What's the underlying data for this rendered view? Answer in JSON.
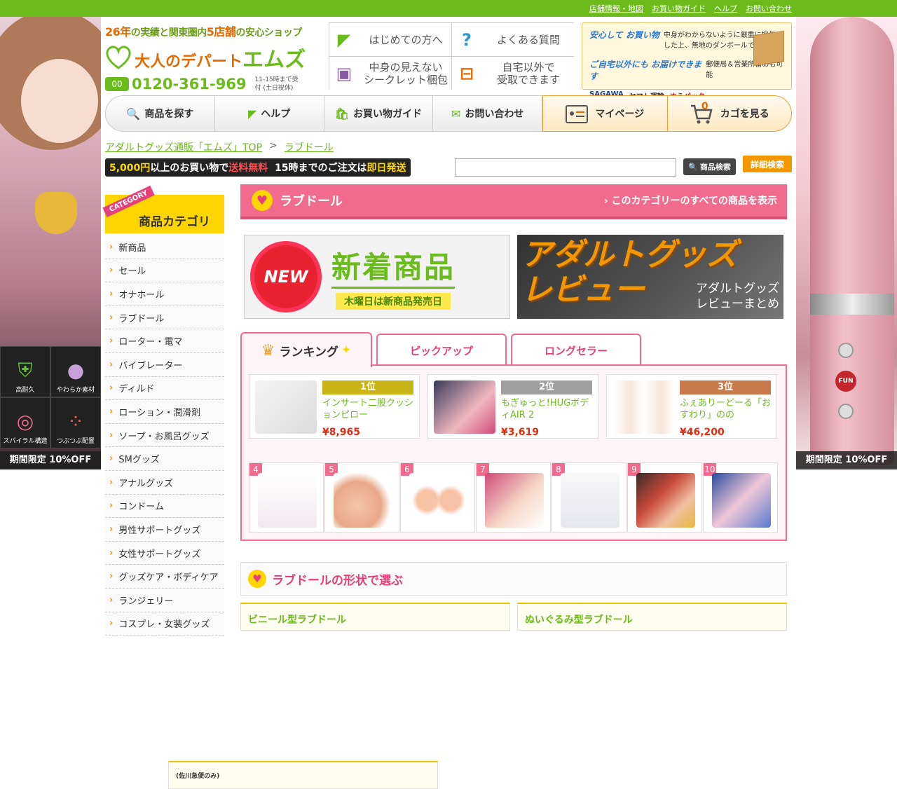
{
  "toplinks": [
    "店舗情報・地図",
    "お買い物ガイド",
    "ヘルプ",
    "お問い合わせ"
  ],
  "left_ad": {
    "footer": "期間限定 10%OFF",
    "badges": [
      "高耐久",
      "やわらか素材",
      "スパイラル構造",
      "つぶつぶ配置"
    ]
  },
  "right_ad": {
    "footer": "期間限定 10%OFF",
    "brand": "FUN"
  },
  "header": {
    "tagline_pre": "26年",
    "tagline_mid": "の実績と関東圏内",
    "tagline_num": "5店舗",
    "tagline_post": "の安心ショップ",
    "brand_pre": "大人のデパート",
    "brand_main": "エムズ",
    "phone_icon": "00",
    "phone": "0120-361-969",
    "phone_note": "11-15時まで受付 (土日祝休)"
  },
  "guide": [
    {
      "label": "はじめての方へ",
      "icon": "beginner-mark-icon",
      "glyph": "◤",
      "color": "#6cbb1c"
    },
    {
      "label": "よくある質問",
      "icon": "question-icon",
      "glyph": "?",
      "color": "#2b9ad6"
    },
    {
      "label": "中身の見えない\nシークレット梱包",
      "icon": "box-icon",
      "glyph": "▣",
      "color": "#8a5aa8"
    },
    {
      "label": "自宅以外で\n受取できます",
      "icon": "pickup-icon",
      "glyph": "⊟",
      "color": "#e36a00"
    }
  ],
  "shipinfo": {
    "h1": "安心して お買い物",
    "t1": "中身がわからないように厳重に梱包した上、無地のダンボールでお届け",
    "h2": "ご自宅以外にも お届けできます",
    "t2": "郵便局＆営業所留めも可能",
    "carriers": [
      "SAGAWA",
      "ヤマト運輸",
      "ゆうパック"
    ]
  },
  "nav": [
    {
      "label": "商品を探す",
      "icon": "search-icon",
      "glyph": "🔍"
    },
    {
      "label": "ヘルプ",
      "icon": "beginner-mark-icon",
      "glyph": "◤"
    },
    {
      "label": "お買い物ガイド",
      "icon": "bag-icon",
      "glyph": "🛍"
    },
    {
      "label": "お問い合わせ",
      "icon": "mail-icon",
      "glyph": "✉"
    }
  ],
  "nav_right": {
    "mypage": "マイページ",
    "cart": "カゴを見る",
    "cart_count": "0"
  },
  "breadcrumb": [
    "アダルトグッズ通販「エムズ」TOP",
    "ラブドール"
  ],
  "shipbar": {
    "amount": "5,000円",
    "mid": "以上のお買い物で",
    "free": "送料無料",
    "time": "15時までのご注文は",
    "same": "即日発送",
    "note": "(佐川急便のみ)"
  },
  "search": {
    "placeholder": "",
    "button": "商品検索",
    "advanced": "詳細検索"
  },
  "category": {
    "ribbon": "CATEGORY",
    "title": "商品カテゴリ",
    "items": [
      "新商品",
      "セール",
      "オナホール",
      "ラブドール",
      "ローター・電マ",
      "バイブレーター",
      "ディルド",
      "ローション・潤滑剤",
      "ソープ・お風呂グッズ",
      "SMグッズ",
      "アナルグッズ",
      "コンドーム",
      "男性サポートグッズ",
      "女性サポートグッズ",
      "グッズケア・ボディケア",
      "ランジェリー",
      "コスプレ・女装グッズ"
    ]
  },
  "page": {
    "title": "ラブドール",
    "link": "このカテゴリーのすべての商品を表示"
  },
  "banner_new": {
    "badge": "NEW",
    "title": "新着商品",
    "sub": "木曜日は新商品発売日"
  },
  "banner_review": {
    "big": "アダルトグッズ\nレビュー",
    "small": "アダルトグッズ\nレビューまとめ"
  },
  "tabs": {
    "ranking": "ランキング",
    "pickup": "ピックアップ",
    "longseller": "ロングセラー"
  },
  "ranking_top": [
    {
      "rank": "1位",
      "name": "インサート二股クッションピロー",
      "price": "¥8,965",
      "color": "#c8b417"
    },
    {
      "rank": "2位",
      "name": "もぎゅっと!HUGボディAIR 2",
      "price": "¥3,619",
      "color": "#a0a0a0"
    },
    {
      "rank": "3位",
      "name": "ふぇありーどーる「おすわり」のの",
      "price": "¥46,200",
      "color": "#c87a4a"
    }
  ],
  "ranking_rest": [
    "4",
    "5",
    "6",
    "7",
    "8",
    "9",
    "10"
  ],
  "shape_section": {
    "title": "ラブドールの形状で選ぶ",
    "sub1": "ビニール型ラブドール",
    "sub2": "ぬいぐるみ型ラブドール"
  }
}
